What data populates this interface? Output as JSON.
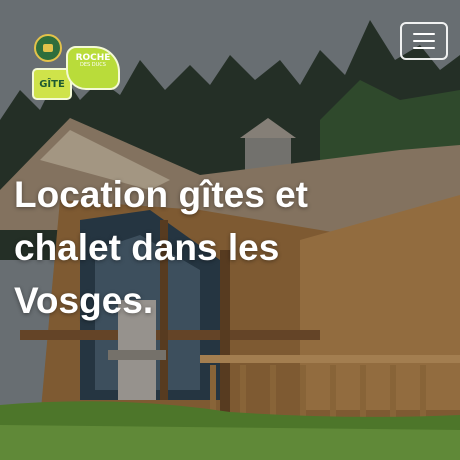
{
  "header": {
    "logo": {
      "text_main": "GÎTE",
      "text_badge_line1": "ROCHE",
      "text_badge_line2": "DES DUCS"
    },
    "menu_icon": "hamburger-icon"
  },
  "hero": {
    "title": "Location gîtes et chalet dans les Vosges."
  },
  "colors": {
    "logo_green": "#b9dc3a",
    "title_text": "#ffffff",
    "sky": "#8a9196",
    "grass": "#6a9a3a",
    "roof": "#9b8a72",
    "wood": "#b58a54"
  }
}
